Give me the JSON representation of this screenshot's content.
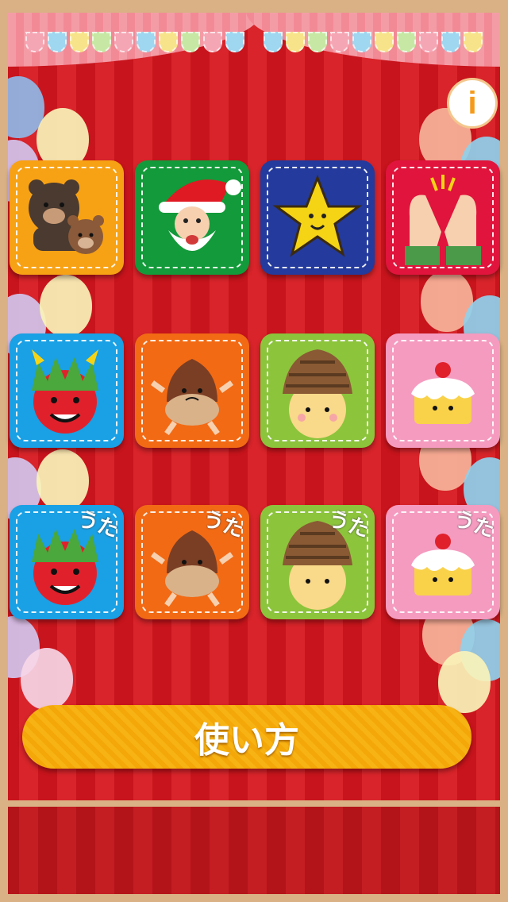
{
  "header": {
    "info_button_label": "i",
    "info_icon": "info-icon"
  },
  "colors": {
    "stage_red": "#c8141c",
    "frame_wood": "#d9b184",
    "help_button": "#f4a708",
    "info_accent": "#f59a18"
  },
  "grid": {
    "rows": [
      [
        {
          "name": "bears",
          "icon": "bears-icon",
          "bg": "#f7a114",
          "song": ""
        },
        {
          "name": "santa",
          "icon": "santa-icon",
          "bg": "#139a3a",
          "song": ""
        },
        {
          "name": "star",
          "icon": "star-icon",
          "bg": "#243a9c",
          "song": ""
        },
        {
          "name": "clapping-hands",
          "icon": "clapping-hands-icon",
          "bg": "#e0143c",
          "song": ""
        }
      ],
      [
        {
          "name": "red-oni",
          "icon": "red-oni-icon",
          "bg": "#1aa0e4",
          "song": ""
        },
        {
          "name": "chestnut",
          "icon": "chestnut-icon",
          "bg": "#f26a14",
          "song": ""
        },
        {
          "name": "acorn-kid",
          "icon": "acorn-kid-icon",
          "bg": "#8cc43c",
          "song": ""
        },
        {
          "name": "cake",
          "icon": "cake-icon",
          "bg": "#f59bc0",
          "song": ""
        }
      ],
      [
        {
          "name": "red-oni-song",
          "icon": "red-oni-icon",
          "bg": "#1aa0e4",
          "song": "うた"
        },
        {
          "name": "chestnut-song",
          "icon": "chestnut-icon",
          "bg": "#f26a14",
          "song": "うた"
        },
        {
          "name": "acorn-kid-song",
          "icon": "acorn-kid-icon",
          "bg": "#8cc43c",
          "song": "うた"
        },
        {
          "name": "cake-song",
          "icon": "cake-icon",
          "bg": "#f59bc0",
          "song": "うた"
        }
      ]
    ]
  },
  "footer": {
    "help_label": "使い方"
  }
}
